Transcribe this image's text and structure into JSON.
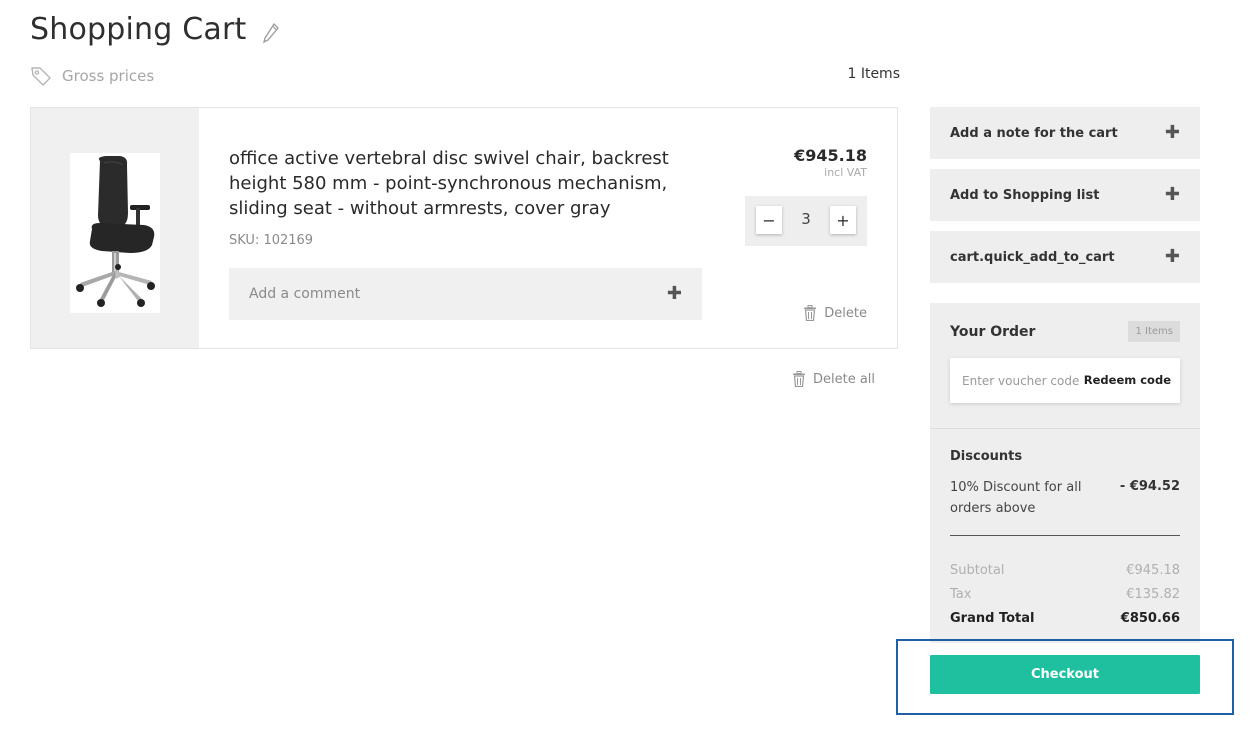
{
  "header": {
    "title": "Shopping Cart",
    "price_mode": "Gross prices",
    "item_count": "1 Items"
  },
  "cart_item": {
    "name": "office active vertebral disc swivel chair, backrest height 580 mm - point-synchronous mechanism, sliding seat - without armrests, cover gray",
    "sku": "SKU: 102169",
    "price": "€945.18",
    "vat_note": "incl VAT",
    "quantity": "3",
    "minus_symbol": "−",
    "plus_symbol": "+",
    "comment_label": "Add a comment",
    "delete_label": "Delete"
  },
  "delete_all_label": "Delete all",
  "sidebar": {
    "actions": [
      {
        "label": "Add a note for the cart"
      },
      {
        "label": "Add to Shopping list"
      },
      {
        "label": "cart.quick_add_to_cart"
      }
    ],
    "plus_glyph": "✚"
  },
  "order": {
    "title": "Your Order",
    "badge": "1 Items",
    "voucher_placeholder": "Enter voucher code",
    "redeem_label": "Redeem code",
    "discounts_title": "Discounts",
    "discount_desc": "10% Discount for all orders above",
    "discount_value": "- €94.52",
    "subtotal_label": "Subtotal",
    "subtotal_value": "€945.18",
    "tax_label": "Tax",
    "tax_value": "€135.82",
    "grand_total_label": "Grand Total",
    "grand_total_value": "€850.66"
  },
  "checkout_label": "Checkout",
  "colors": {
    "checkout": "#1fc0a0",
    "highlight_border": "#1f5fa8",
    "panel_bg": "#eeeeee"
  },
  "icons": [
    "edit-pencil-icon",
    "price-tag-icon",
    "chair-product-image",
    "trash-icon",
    "plus-icon"
  ]
}
